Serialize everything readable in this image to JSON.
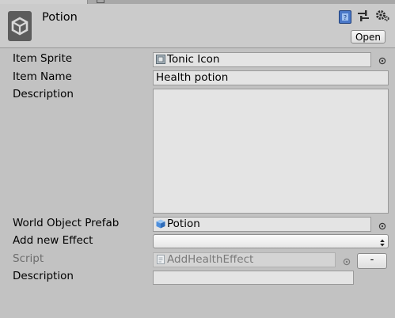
{
  "header": {
    "title": "Potion",
    "open_label": "Open"
  },
  "fields": {
    "item_sprite": {
      "label": "Item Sprite",
      "value": "Tonic Icon"
    },
    "item_name": {
      "label": "Item Name",
      "value": "Health potion"
    },
    "description": {
      "label": "Description",
      "value": ""
    },
    "world_object_prefab": {
      "label": "World Object Prefab",
      "value": "Potion"
    },
    "add_new_effect": {
      "label": "Add new Effect",
      "value": ""
    }
  },
  "effect": {
    "script_label": "Script",
    "script_value": "AddHealthEffect",
    "remove_label": "-",
    "description_label": "Description",
    "description_value": ""
  },
  "icons": {
    "header": [
      "unity-logo-icon",
      "help-book-icon",
      "presets-icon",
      "gear-icon"
    ],
    "fields": [
      "sprite-icon",
      "prefab-cube-icon",
      "script-icon",
      "object-picker-icon"
    ]
  },
  "colors": {
    "background": "#c2c2c2",
    "field": "#e4e4e4",
    "help_icon": "#4a78c8",
    "prefab_icon": "#4f8fdc"
  }
}
